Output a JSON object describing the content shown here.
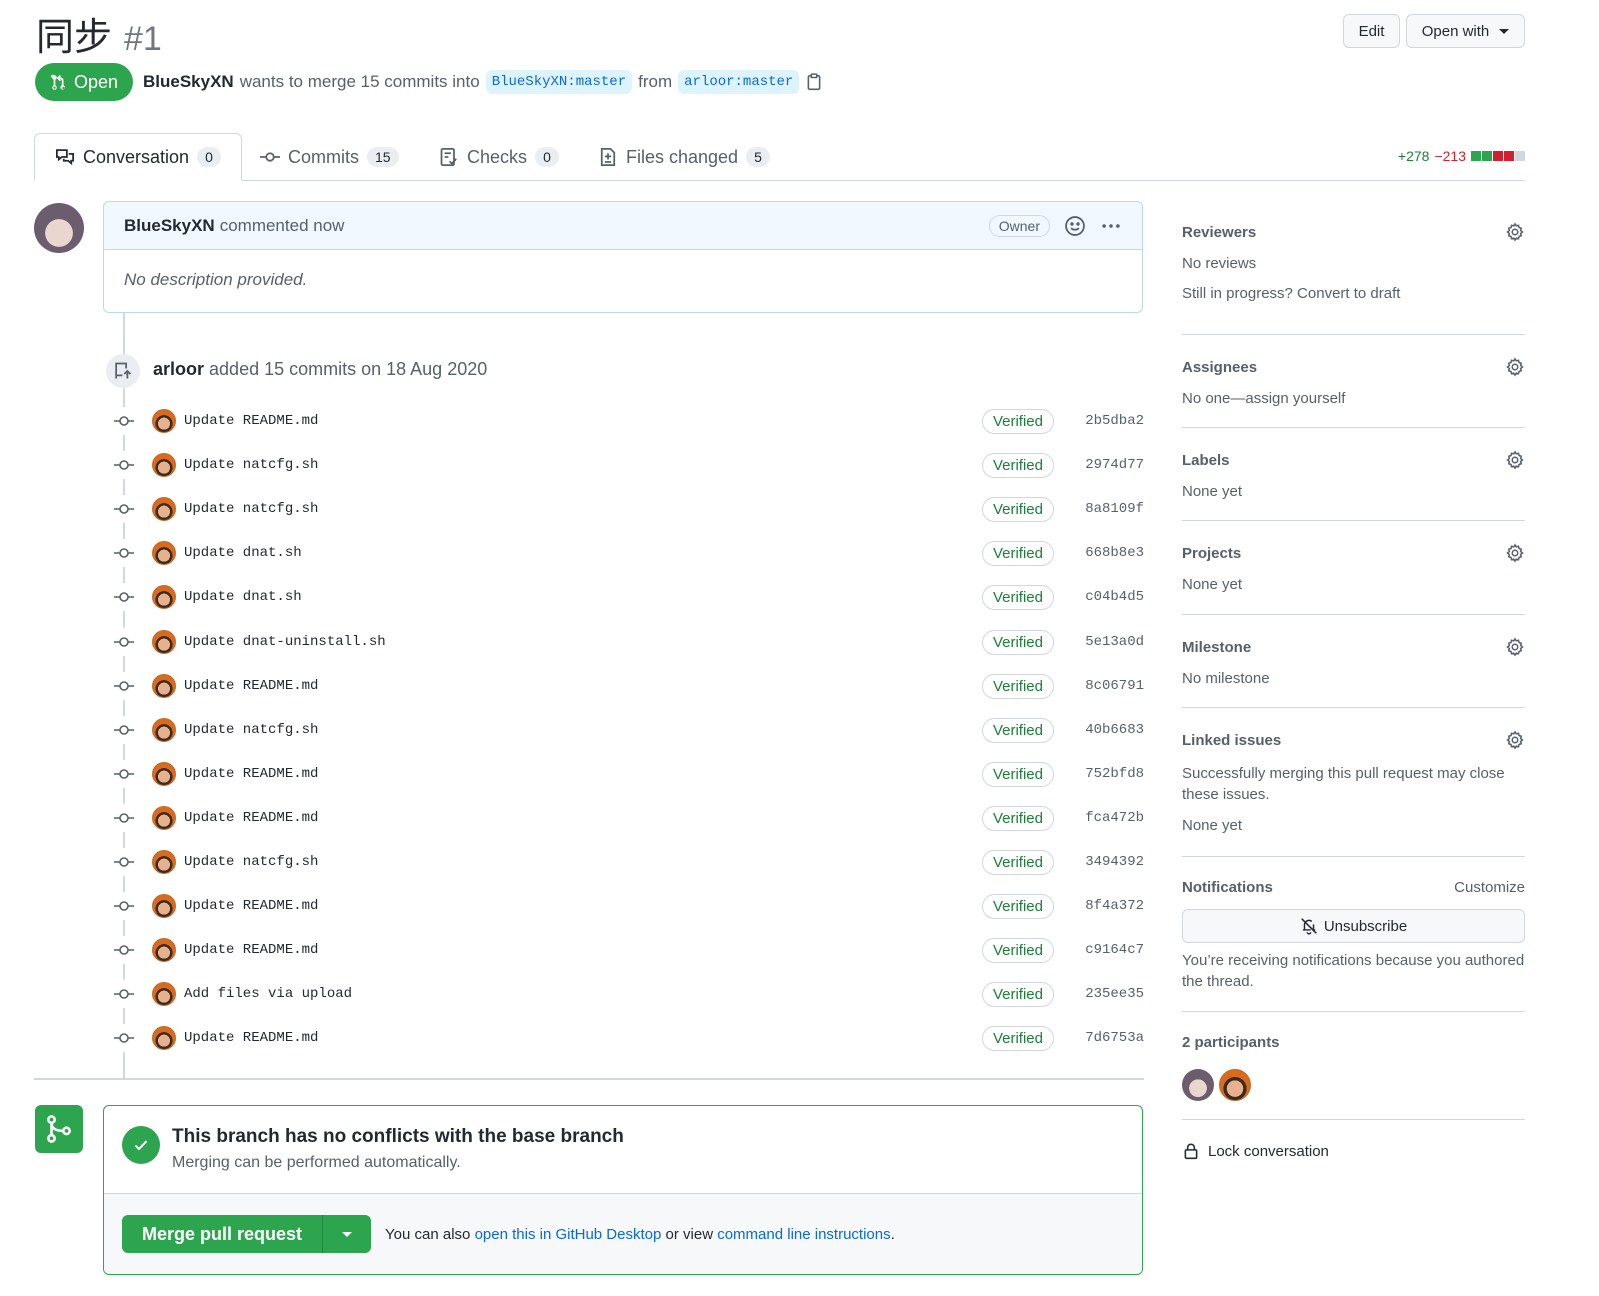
{
  "pr": {
    "title": "同步",
    "number": "#1",
    "state": "Open",
    "author": "BlueSkyXN",
    "meta_text": "wants to merge 15 commits into",
    "base_branch": "BlueSkyXN:master",
    "from_text": "from",
    "head_branch": "arloor:master"
  },
  "header": {
    "edit_label": "Edit",
    "open_with_label": "Open with"
  },
  "tabs": [
    {
      "label": "Conversation",
      "count": "0"
    },
    {
      "label": "Commits",
      "count": "15"
    },
    {
      "label": "Checks",
      "count": "0"
    },
    {
      "label": "Files changed",
      "count": "5"
    }
  ],
  "diffstat": {
    "additions": "+278",
    "deletions": "−213",
    "colors": {
      "add": "#2da44e",
      "del": "#cf222e",
      "neutral": "#d0d7de"
    }
  },
  "comment": {
    "author": "BlueSkyXN",
    "time": "commented now",
    "role": "Owner",
    "body": "No description provided."
  },
  "push": {
    "author": "arloor",
    "text": "added 15 commits on 18 Aug 2020"
  },
  "commits": [
    {
      "message": "Update README.md",
      "badge": "Verified",
      "sha": "2b5dba2"
    },
    {
      "message": "Update natcfg.sh",
      "badge": "Verified",
      "sha": "2974d77"
    },
    {
      "message": "Update natcfg.sh",
      "badge": "Verified",
      "sha": "8a8109f"
    },
    {
      "message": "Update dnat.sh",
      "badge": "Verified",
      "sha": "668b8e3"
    },
    {
      "message": "Update dnat.sh",
      "badge": "Verified",
      "sha": "c04b4d5"
    },
    {
      "message": "Update dnat-uninstall.sh",
      "badge": "Verified",
      "sha": "5e13a0d"
    },
    {
      "message": "Update README.md",
      "badge": "Verified",
      "sha": "8c06791"
    },
    {
      "message": "Update natcfg.sh",
      "badge": "Verified",
      "sha": "40b6683"
    },
    {
      "message": "Update README.md",
      "badge": "Verified",
      "sha": "752bfd8"
    },
    {
      "message": "Update README.md",
      "badge": "Verified",
      "sha": "fca472b"
    },
    {
      "message": "Update natcfg.sh",
      "badge": "Verified",
      "sha": "3494392"
    },
    {
      "message": "Update README.md",
      "badge": "Verified",
      "sha": "8f4a372"
    },
    {
      "message": "Update README.md",
      "badge": "Verified",
      "sha": "c9164c7"
    },
    {
      "message": "Add files via upload",
      "badge": "Verified",
      "sha": "235ee35"
    },
    {
      "message": "Update README.md",
      "badge": "Verified",
      "sha": "7d6753a"
    }
  ],
  "merge": {
    "title": "This branch has no conflicts with the base branch",
    "subtitle": "Merging can be performed automatically.",
    "button": "Merge pull request",
    "help_prefix": "You can also",
    "help_link1": "open this in GitHub Desktop",
    "help_mid": "or view",
    "help_link2": "command line instructions",
    "help_suffix": "."
  },
  "sidebar": {
    "reviewers": {
      "heading": "Reviewers",
      "value": "No reviews",
      "extra": "Still in progress? Convert to draft"
    },
    "assignees": {
      "heading": "Assignees",
      "value": "No one—assign yourself"
    },
    "labels": {
      "heading": "Labels",
      "value": "None yet"
    },
    "projects": {
      "heading": "Projects",
      "value": "None yet"
    },
    "milestone": {
      "heading": "Milestone",
      "value": "No milestone"
    },
    "linked": {
      "heading": "Linked issues",
      "desc": "Successfully merging this pull request may close these issues.",
      "value": "None yet"
    },
    "notifications": {
      "heading": "Notifications",
      "customize": "Customize",
      "button": "Unsubscribe",
      "desc": "You’re receiving notifications because you authored the thread."
    },
    "participants": {
      "heading": "2 participants"
    },
    "lock": "Lock conversation"
  },
  "icons": [
    "pull-request-icon",
    "clipboard-icon",
    "conversation-icon",
    "commit-icon",
    "checks-icon",
    "file-diff-icon",
    "smiley-icon",
    "kebab-icon",
    "push-icon",
    "git-commit-icon",
    "merge-icon",
    "check-icon",
    "gear-icon",
    "bell-slash-icon",
    "lock-icon"
  ]
}
